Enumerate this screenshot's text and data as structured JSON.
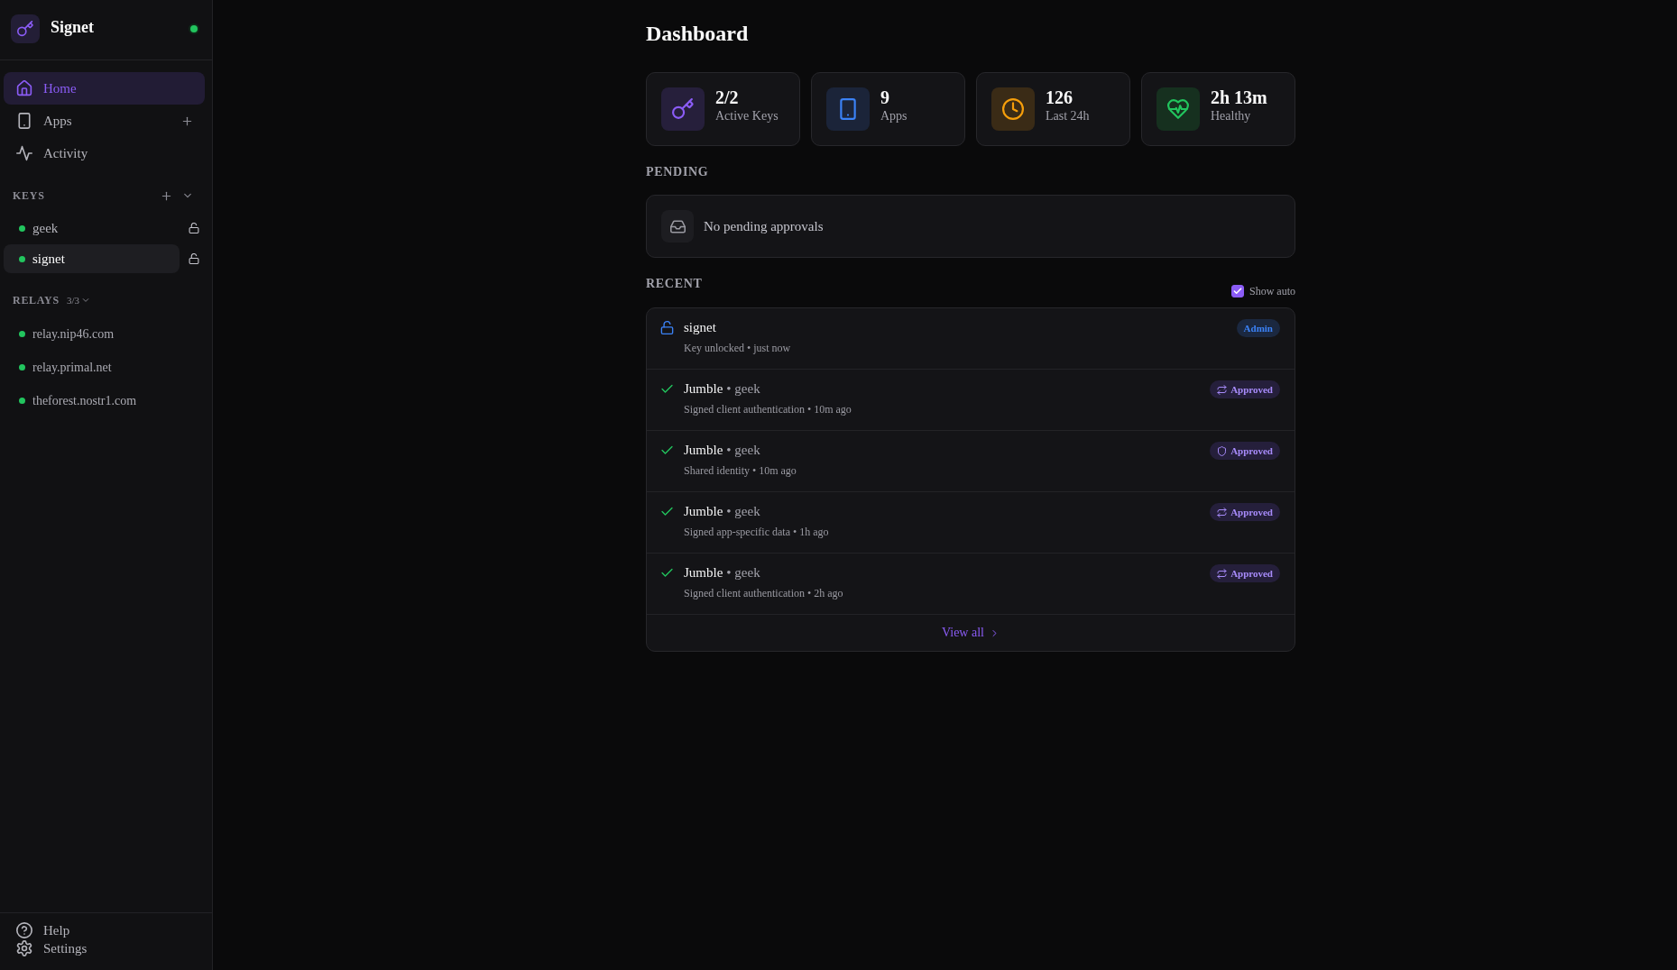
{
  "sidebar": {
    "brand": {
      "name": "Signet",
      "online": true
    },
    "nav": [
      {
        "kind": "home",
        "label": "Home",
        "selected": true,
        "add_button": false
      },
      {
        "kind": "apps",
        "label": "Apps",
        "selected": false,
        "add_button": true
      },
      {
        "kind": "activity",
        "label": "Activity",
        "selected": false,
        "add_button": false
      }
    ],
    "keys": {
      "title": "KEYS",
      "expanded": true,
      "items": [
        {
          "name": "geek",
          "online": true,
          "locked": false,
          "selected": false
        },
        {
          "name": "signet",
          "online": true,
          "locked": false,
          "selected": true
        }
      ]
    },
    "relays": {
      "title": "RELAYS",
      "count": "3/3",
      "expanded": true,
      "items": [
        {
          "url": "relay.nip46.com",
          "connected": true
        },
        {
          "url": "relay.primal.net",
          "connected": true
        },
        {
          "url": "theforest.nostr1.com",
          "connected": true
        }
      ]
    },
    "footer": [
      {
        "kind": "help",
        "label": "Help"
      },
      {
        "kind": "settings",
        "label": "Settings"
      }
    ]
  },
  "main": {
    "title": "Dashboard",
    "stats": [
      {
        "kind": "keys",
        "value": "2/2",
        "label": "Active Keys"
      },
      {
        "kind": "apps",
        "value": "9",
        "label": "Apps"
      },
      {
        "kind": "requests",
        "value": "126",
        "label": "Last 24h"
      },
      {
        "kind": "uptime",
        "value": "2h 13m",
        "label": "Healthy"
      }
    ],
    "pending": {
      "title": "PENDING",
      "empty_text": "No pending approvals"
    },
    "recent": {
      "title": "RECENT",
      "show_auto": {
        "label": "Show auto",
        "checked": true
      },
      "items": [
        {
          "kind": "unlock",
          "title": "signet",
          "subtitle": "Key unlocked • just now",
          "badge": {
            "kind": "admin",
            "label": "Admin"
          }
        },
        {
          "kind": "approved",
          "title": "Jumble",
          "detail": "• geek",
          "subtitle": "Signed client authentication • 10m ago",
          "badge": {
            "kind": "signing",
            "label": "Approved"
          }
        },
        {
          "kind": "approved",
          "title": "Jumble",
          "detail": "• geek",
          "subtitle": "Shared identity • 10m ago",
          "badge": {
            "kind": "identity",
            "label": "Approved"
          }
        },
        {
          "kind": "approved",
          "title": "Jumble",
          "detail": "• geek",
          "subtitle": "Signed app-specific data • 1h ago",
          "badge": {
            "kind": "signing",
            "label": "Approved"
          }
        },
        {
          "kind": "approved",
          "title": "Jumble",
          "detail": "• geek",
          "subtitle": "Signed client authentication • 2h ago",
          "badge": {
            "kind": "signing",
            "label": "Approved"
          }
        }
      ],
      "view_all": "View all"
    }
  }
}
